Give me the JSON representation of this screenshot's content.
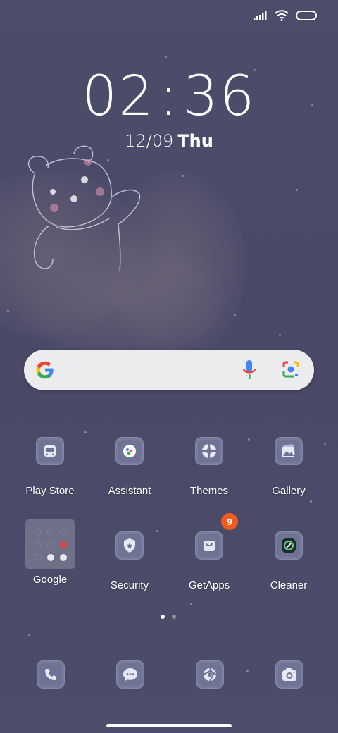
{
  "status_bar": {
    "signal_icon": "signal-bars-icon",
    "wifi_icon": "wifi-icon",
    "battery_icon": "battery-icon"
  },
  "clock": {
    "hours": "02",
    "minutes": "36"
  },
  "date": {
    "date_text": "12/09",
    "weekday": "Thu"
  },
  "search_widget": {
    "logo": "google-g-icon",
    "mic_icon": "microphone-icon",
    "lens_icon": "google-lens-icon"
  },
  "apps_row1": [
    {
      "label": "Play Store",
      "icon": "play-store-icon"
    },
    {
      "label": "Assistant",
      "icon": "assistant-icon"
    },
    {
      "label": "Themes",
      "icon": "themes-icon"
    },
    {
      "label": "Gallery",
      "icon": "gallery-icon"
    }
  ],
  "apps_row2": [
    {
      "label": "Google",
      "icon": "folder-icon"
    },
    {
      "label": "Security",
      "icon": "security-shield-icon"
    },
    {
      "label": "GetApps",
      "icon": "getapps-bag-icon",
      "badge": "9"
    },
    {
      "label": "Cleaner",
      "icon": "cleaner-icon"
    }
  ],
  "page_indicator": {
    "pages": 2,
    "current": 1
  },
  "dock": [
    {
      "icon": "phone-icon"
    },
    {
      "icon": "messages-icon"
    },
    {
      "icon": "browser-icon"
    },
    {
      "icon": "camera-icon"
    }
  ],
  "colors": {
    "wallpaper": "#4b4b69",
    "icon_tile": "#6f7396",
    "badge": "#f15a1d",
    "search_bar": "#ececef"
  }
}
